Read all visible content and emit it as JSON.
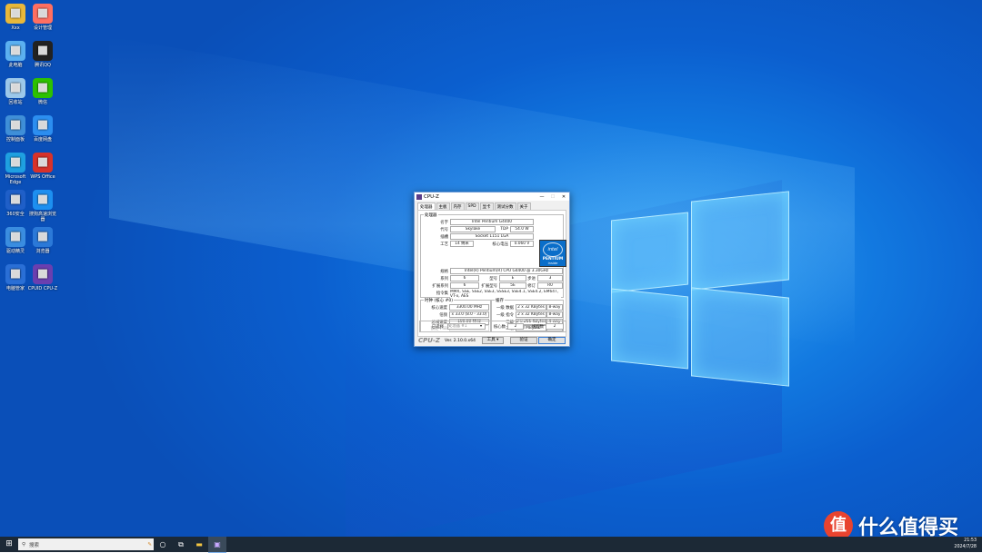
{
  "desktop": {
    "icons": [
      {
        "label": "Xxx",
        "icon": "folder-user-icon",
        "color": "#e8b83a"
      },
      {
        "label": "设计管理",
        "icon": "colorful-app-icon",
        "color": "#ff6f61"
      },
      {
        "label": "此电脑",
        "icon": "computer-icon",
        "color": "#5bb0f0"
      },
      {
        "label": "腾讯QQ",
        "icon": "qq-penguin-icon",
        "color": "#222222"
      },
      {
        "label": "回收站",
        "icon": "recycle-bin-icon",
        "color": "#9cc8ea"
      },
      {
        "label": "微信",
        "icon": "wechat-icon",
        "color": "#2dc100"
      },
      {
        "label": "控制面板",
        "icon": "control-panel-icon",
        "color": "#3f8fd8"
      },
      {
        "label": "百度网盘",
        "icon": "cloud-icon",
        "color": "#2c8ef0"
      },
      {
        "label": "Microsoft Edge",
        "icon": "edge-icon",
        "color": "#1fa0e0"
      },
      {
        "label": "WPS Office",
        "icon": "wps-icon",
        "color": "#d7322a"
      },
      {
        "label": "360安全",
        "icon": "security-ball-icon",
        "color": "#1f5fc8"
      },
      {
        "label": "搜狗高速浏览器",
        "icon": "sogou-icon",
        "color": "#1d8ff0"
      },
      {
        "label": "驱动精灵",
        "icon": "bird-icon",
        "color": "#3a8de0"
      },
      {
        "label": "浏览器",
        "icon": "ie-icon",
        "color": "#2b79d8"
      },
      {
        "label": "电脑管家",
        "icon": "shield-check-icon",
        "color": "#2a6fd6"
      },
      {
        "label": "CPUID CPU-Z",
        "icon": "cpuz-chip-icon",
        "color": "#6a3fb0"
      }
    ]
  },
  "cpuz": {
    "title": "CPU-Z",
    "tabs": [
      "处理器",
      "主板",
      "内存",
      "SPD",
      "显卡",
      "测试分数",
      "关于"
    ],
    "processor_group": "处理器",
    "name_label": "名字",
    "name": "Intel Pentium G4400",
    "codename_label": "代号",
    "codename": "Skylake",
    "tdp_label": "TDP",
    "tdp": "54.0 W",
    "package_label": "插槽",
    "package": "Socket 1151 LGA",
    "tech_label": "工艺",
    "tech": "14 纳米",
    "voltage_label": "核心电压",
    "voltage": "0.060 V",
    "spec_label": "规格",
    "spec": "Intel(R) Pentium(R) CPU G4400 @ 3.30GHz",
    "family_label": "系列",
    "family": "6",
    "model_label": "型号",
    "model": "E",
    "stepping_label": "步进",
    "stepping": "3",
    "ext_family_label": "扩展系列",
    "ext_family": "6",
    "ext_model_label": "扩展型号",
    "ext_model": "5E",
    "revision_label": "修订",
    "revision": "R0",
    "instructions_label": "指令集",
    "instructions": "MMX, SSE, SSE2, SSE3, SSSE3, SSE4.1, SSE4.2, EM64T, VT-x, AES",
    "intel_logo": {
      "brand": "intel",
      "line": "PENTIUM",
      "sub": "inside"
    },
    "clocks_group": "时钟 (核心 #0)",
    "core_speed_label": "核心速度",
    "core_speed": "3300.00 MHz",
    "multiplier_label": "倍频",
    "multiplier": "x 33.0 (8.0 - 33.0)",
    "bus_speed_label": "总线速度",
    "bus_speed": "100.00 MHz",
    "rated_fsb_label": "额定 FSB",
    "rated_fsb": "",
    "cache_group": "缓存",
    "l1d_label": "一级 数据",
    "l1d": "2 x 32 KBytes",
    "l1d_way": "8-way",
    "l1i_label": "一级 指令",
    "l1i": "2 x 32 KBytes",
    "l1i_way": "8-way",
    "l2_label": "二级",
    "l2": "2 x 256 KBytes",
    "l2_way": "4-way",
    "l3_label": "三级",
    "l3": "3 MBytes",
    "l3_way": "12-way",
    "selection_label": "已选择",
    "selection": "处理器 #1",
    "cores_label": "核心数",
    "cores": "2",
    "threads_label": "线程数",
    "threads": "2",
    "footer_logo": "CPU-Z",
    "version": "Ver. 2.10.0.x64",
    "tools_button": "工具",
    "validate_button": "验证",
    "ok_button": "确定"
  },
  "taskbar": {
    "search_placeholder": "搜索",
    "clock_time": "21:53",
    "clock_date": "2024/7/28"
  },
  "watermark": {
    "badge": "值",
    "text": "什么值得买"
  }
}
